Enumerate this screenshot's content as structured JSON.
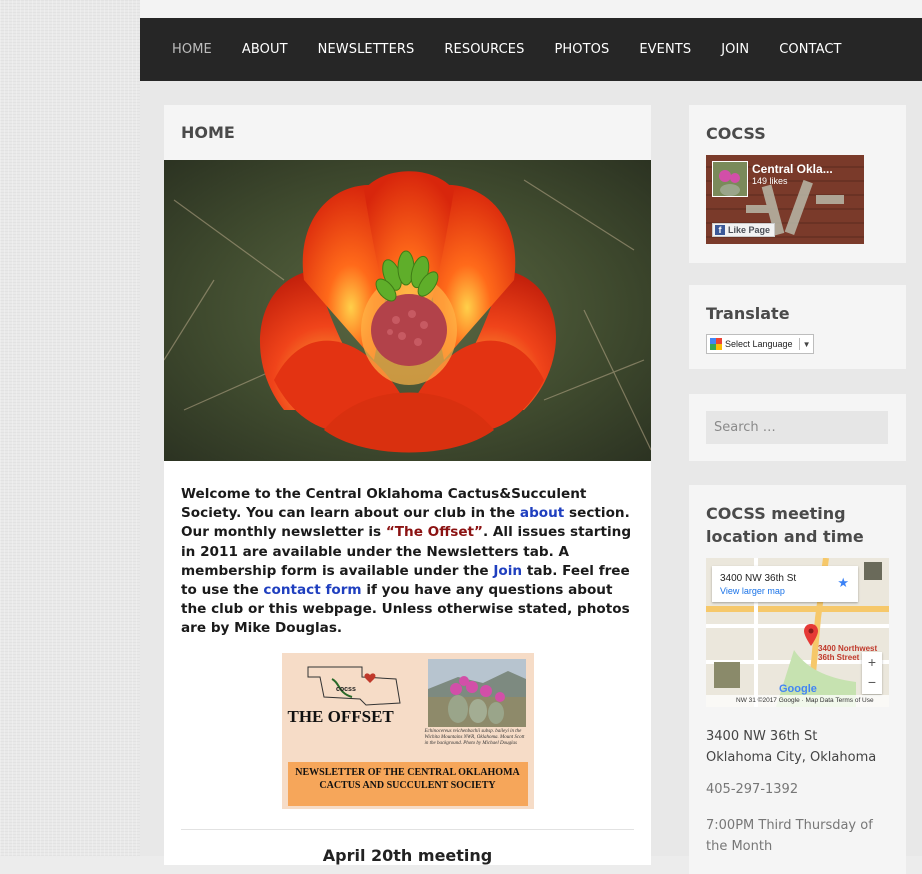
{
  "nav": {
    "items": [
      "HOME",
      "ABOUT",
      "NEWSLETTERS",
      "RESOURCES",
      "PHOTOS",
      "EVENTS",
      "JOIN",
      "CONTACT"
    ],
    "active": "HOME"
  },
  "main": {
    "title": "HOME",
    "intro": {
      "p1": "Welcome to the Central Oklahoma Cactus&Succulent Society. You can learn about our club in the ",
      "about_link": "about",
      "p2": " section. Our monthly newsletter is ",
      "offset": "“The Offset”",
      "p3": ".  All issues starting in 2011 are available under the Newsletters tab. A membership form is available under the ",
      "join_link": "Join",
      "p4": " tab.  Feel free to use the ",
      "contact_link": "contact form",
      "p5": " if you have any questions about the club or this webpage.  Unless otherwise stated, photos are by Mike Douglas."
    },
    "newsletter": {
      "logo_text": "cocss",
      "title": "THE OFFSET",
      "caption": "Echinocereus reichenbachii subsp. baileyi in the Wichita Mountains NWR, Oklahoma. Mount Scott in the background. Photo by Michael Douglas",
      "band": "NEWSLETTER OF THE CENTRAL OKLAHOMA CACTUS AND SUCCULENT SOCIETY"
    },
    "meeting_title": "April 20th meeting"
  },
  "sidebar": {
    "cocss": {
      "title": "COCSS",
      "fb_name": "Central Okla...",
      "fb_likes": "149 likes",
      "fb_button": "Like Page"
    },
    "translate": {
      "title": "Translate",
      "select_label": "Select Language",
      "arrow": "▼"
    },
    "search": {
      "placeholder": "Search …"
    },
    "meeting": {
      "title": "COCSS meeting location and time",
      "map_card_title": "3400 NW 36th St",
      "map_card_link": "View larger map",
      "map_pin_label": "3400 Northwest 36th Street",
      "map_footer": "NW 31 ©2017 Google · Map Data    Terms of Use",
      "map_logo": "Google",
      "zoom_in": "+",
      "zoom_out": "−",
      "address_line1": "3400 NW 36th St",
      "address_line2": "Oklahoma City, Oklahoma",
      "phone": "405-297-1392",
      "time": "7:00PM Third Thursday of the Month"
    }
  }
}
